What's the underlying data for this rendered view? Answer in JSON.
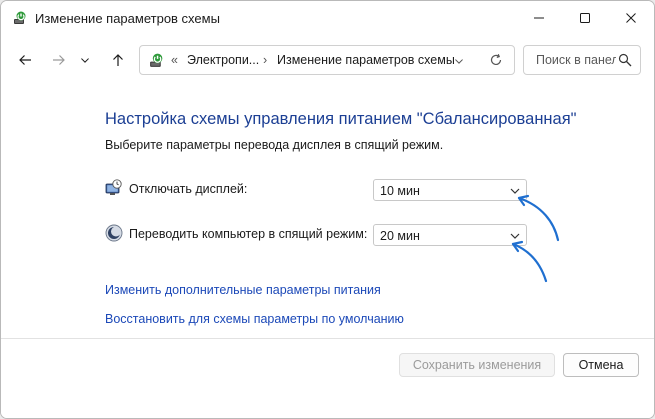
{
  "window": {
    "title": "Изменение параметров схемы",
    "controls": {
      "minimize": "minimize-icon",
      "maximize": "maximize-icon",
      "close": "close-icon"
    }
  },
  "navbar": {
    "back_icon": "arrow-left-icon",
    "forward_icon": "arrow-right-icon",
    "history_icon": "chevron-down-icon",
    "up_icon": "arrow-up-icon",
    "address": {
      "overflow": "«",
      "crumbs": [
        "Электропи...",
        "Изменение параметров схемы"
      ],
      "separator": "›"
    },
    "refresh_icon": "refresh-icon",
    "search": {
      "placeholder": "Поиск в панели управления"
    }
  },
  "main": {
    "heading": "Настройка схемы управления питанием \"Сбалансированная\"",
    "subheading": "Выберите параметры перевода дисплея в спящий режим.",
    "settings": [
      {
        "label": "Отключать дисплей:",
        "value": "10 мин",
        "icon": "display-clock-icon"
      },
      {
        "label": "Переводить компьютер в спящий режим:",
        "value": "20 мин",
        "icon": "sleep-moon-icon"
      }
    ],
    "links": [
      "Изменить дополнительные параметры питания",
      "Восстановить для схемы параметры по умолчанию"
    ]
  },
  "footer": {
    "save_label": "Сохранить изменения",
    "cancel_label": "Отмена"
  },
  "colors": {
    "heading": "#1c3f94",
    "link": "#1c49b8",
    "annotation_arrow": "#1f6fd0"
  }
}
